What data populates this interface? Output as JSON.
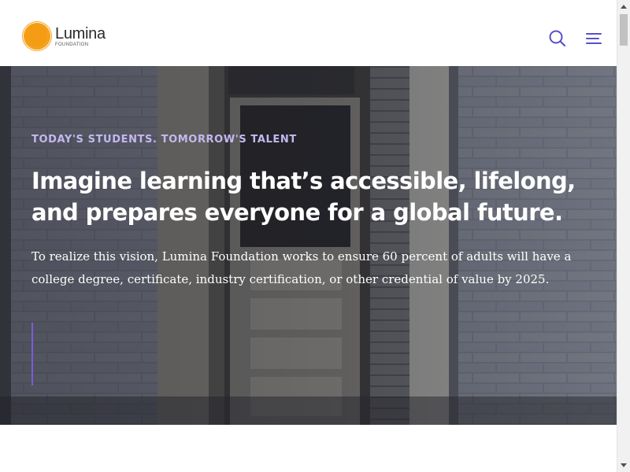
{
  "header": {
    "logo": {
      "name": "Lumina",
      "subtitle": "FOUNDATION",
      "brand_color": "#f39c14"
    },
    "icons": {
      "search": "search-icon",
      "menu": "hamburger-menu-icon",
      "icon_color": "#5a4fcf"
    }
  },
  "hero": {
    "eyebrow": "TODAY'S STUDENTS. TOMORROW'S TALENT",
    "headline": "Imagine learning that’s accessible, lifelong, and prepares everyone for a global future.",
    "body": "To realize this vision, Lumina Foundation works to ensure 60 percent of adults will have a college degree, certificate, industry certification, or other credential of value by 2025.",
    "eyebrow_color": "#c5b8f0",
    "accent_color": "#7c5cd6"
  },
  "scrollbar": {
    "up_arrow": "chevron-up-icon",
    "down_arrow": "chevron-down-icon"
  }
}
